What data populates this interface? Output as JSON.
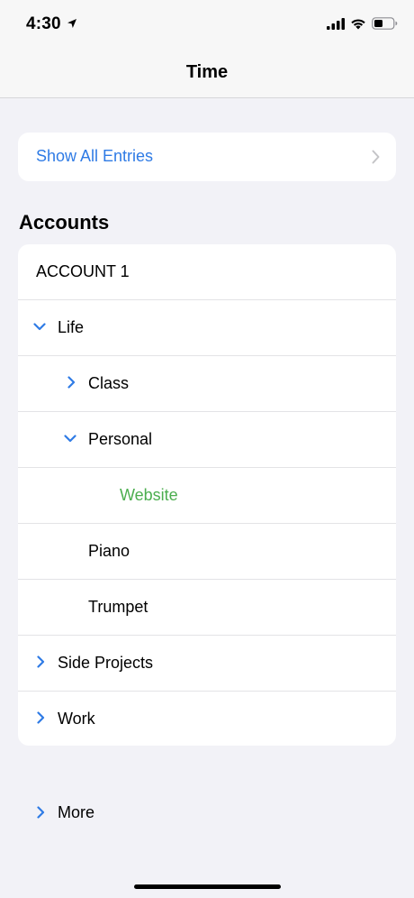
{
  "status_bar": {
    "time": "4:30",
    "location_icon": "location-arrow-icon",
    "signal_icon": "cellular-signal-icon",
    "wifi_icon": "wifi-icon",
    "battery_icon": "battery-icon"
  },
  "nav": {
    "title": "Time"
  },
  "show_all": {
    "label": "Show All Entries",
    "chevron_icon": "chevron-right-icon"
  },
  "accounts": {
    "header": "Accounts",
    "rows": [
      {
        "label": "ACCOUNT 1",
        "chevron": "none"
      },
      {
        "label": "Life",
        "chevron": "down"
      },
      {
        "label": "Class",
        "chevron": "right"
      },
      {
        "label": "Personal",
        "chevron": "down"
      },
      {
        "label": "Website",
        "chevron": "none"
      },
      {
        "label": "Piano",
        "chevron": "none"
      },
      {
        "label": "Trumpet",
        "chevron": "none"
      },
      {
        "label": "Side Projects",
        "chevron": "right"
      },
      {
        "label": "Work",
        "chevron": "right"
      }
    ]
  },
  "more": {
    "label": "More",
    "chevron": "right"
  },
  "colors": {
    "accent_blue": "#2f7be5",
    "selected_green": "#4cae4f",
    "background": "#f2f2f7"
  }
}
